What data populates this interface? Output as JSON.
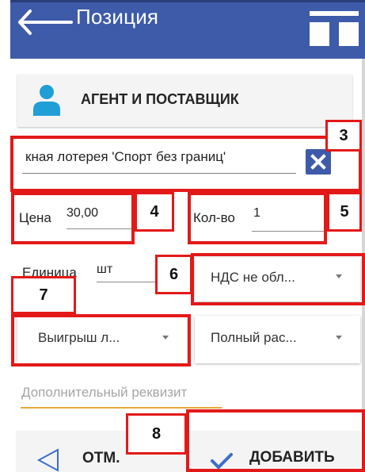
{
  "header": {
    "title": "Позиция",
    "back_icon": "arrow-left-icon",
    "menu_icon": "grid-icon",
    "color": "#3d5ba9"
  },
  "agent": {
    "label": "АГЕНТ И ПОСТАВЩИК",
    "icon": "person-icon",
    "icon_color": "#1f9fd6"
  },
  "product": {
    "name": "кная лотерея 'Спорт без границ'",
    "clear_icon": "close-icon"
  },
  "price": {
    "label": "Цена",
    "value": "30,00"
  },
  "quantity": {
    "label": "Кол-во",
    "value": "1"
  },
  "unit": {
    "label": "Единица",
    "value": "шт"
  },
  "vat": {
    "selected": "НДС не обл..."
  },
  "subject": {
    "selected": "Выигрыш л..."
  },
  "payment_method": {
    "selected": "Полный рас..."
  },
  "extra_field": {
    "placeholder": "Дополнительный реквизит",
    "accent": "#e7a83a"
  },
  "footer": {
    "cancel_label": "ОТМ.",
    "add_label": "ДОБАВИТЬ",
    "cancel_icon": "triangle-left-icon",
    "add_icon": "checkmark-icon",
    "accent": "#3d5ba9"
  },
  "annotations": {
    "color": "#e31919",
    "badges": [
      "3",
      "4",
      "5",
      "6",
      "7",
      "8"
    ]
  }
}
